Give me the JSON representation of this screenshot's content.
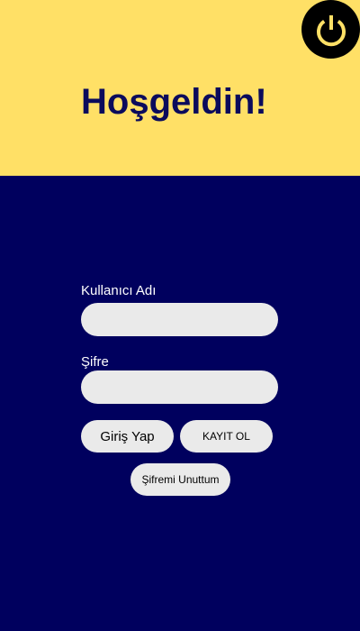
{
  "header": {
    "title": "Hoşgeldin!",
    "power_icon": "power-icon"
  },
  "login_form": {
    "username_label": "Kullanıcı Adı",
    "username_value": "",
    "password_label": "Şifre",
    "password_value": "",
    "login_button": "Giriş Yap",
    "register_button": "KAYIT OL",
    "forgot_password_button": "Şifremi Unuttum"
  },
  "colors": {
    "header_bg": "#FFE066",
    "main_bg": "#00005E",
    "title_text": "#0B0B5C",
    "power_icon": "#FFE066",
    "power_button_bg": "#000000",
    "input_bg": "#EAEAEA",
    "button_bg": "#EAEAEA",
    "label_text": "#FFFFFF",
    "button_text": "#000000"
  }
}
